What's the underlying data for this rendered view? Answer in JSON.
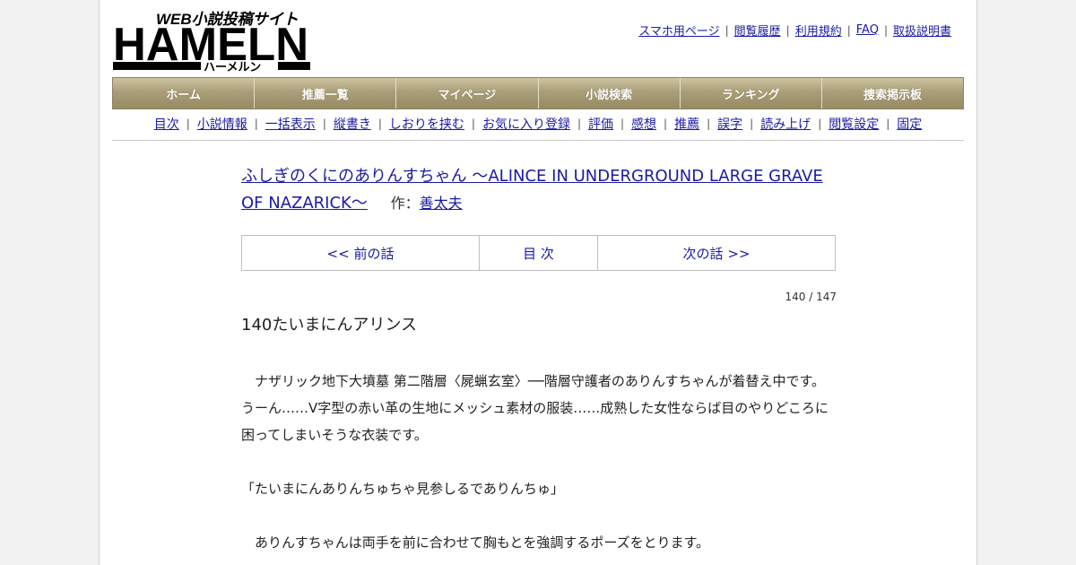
{
  "logo": {
    "brand": "HAMELN",
    "tagline": "WEB小説投稿サイト",
    "reading": "ハーメルン"
  },
  "top_links": [
    "スマホ用ページ",
    "閲覧履歴",
    "利用規約",
    "FAQ",
    "取扱説明書"
  ],
  "main_nav": [
    "ホーム",
    "推薦一覧",
    "マイページ",
    "小説検索",
    "ランキング",
    "捜索掲示板"
  ],
  "sub_nav": [
    "目次",
    "小説情報",
    "一括表示",
    "縦書き",
    "しおりを挟む",
    "お気に入り登録",
    "評価",
    "感想",
    "推薦",
    "誤字",
    "読み上げ",
    "閲覧設定",
    "固定"
  ],
  "novel": {
    "title": "ふしぎのくにのありんすちゃん ～ALINCE IN UNDERGROUND LARGE GRAVE OF NAZARICK～",
    "author_label": "作：",
    "author": "善太夫"
  },
  "pager": {
    "prev": "<< 前の話",
    "toc": "目 次",
    "next": "次の話 >>"
  },
  "page_count": "140 / 147",
  "chapter_title": "140たいまにんアリンス",
  "paragraphs": [
    "　ナザリック地下大墳墓 第二階層〈屍蝋玄室〉──階層守護者のありんすちゃんが着替え中です。うーん……V字型の赤い革の生地にメッシュ素材の服装……成熟した女性ならば目のやりどころに困ってしまいそうな衣装です。",
    "「たいまにんありんちゅちゃ見参しるでありんちゅ」",
    "　ありんすちゃんは両手を前に合わせて胸もとを強調するポーズをとります。"
  ]
}
